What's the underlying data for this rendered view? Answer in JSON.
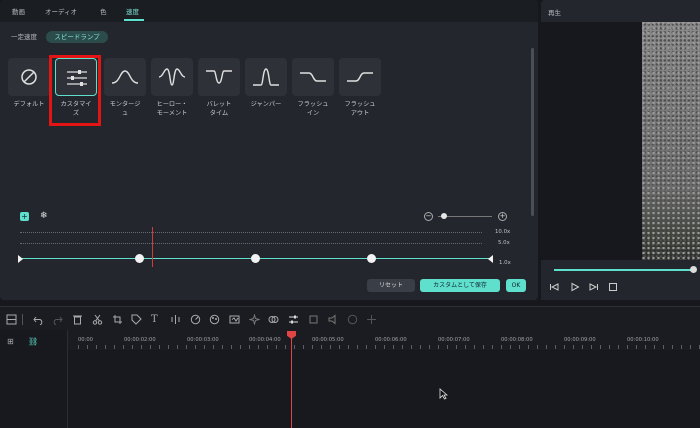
{
  "tabs": [
    "動画",
    "オーディオ",
    "色",
    "速度"
  ],
  "active_tab": "速度",
  "subtabs": [
    "一定速度",
    "スピードランプ"
  ],
  "active_subtab": "スピードランプ",
  "presets": [
    {
      "line1": "デフォルト",
      "line2": "",
      "icon": "none-icon"
    },
    {
      "line1": "カスタマイ",
      "line2": "ズ",
      "icon": "sliders-icon"
    },
    {
      "line1": "モンタージ",
      "line2": "ュ",
      "icon": "montage-curve-icon"
    },
    {
      "line1": "ヒーロー・",
      "line2": "モーメント",
      "icon": "hero-curve-icon"
    },
    {
      "line1": "バレット",
      "line2": "タイム",
      "icon": "bullet-curve-icon"
    },
    {
      "line1": "ジャンパー",
      "line2": "",
      "icon": "jumper-curve-icon"
    },
    {
      "line1": "フラッシュ",
      "line2": "イン",
      "icon": "flash-in-curve-icon"
    },
    {
      "line1": "フラッシュ",
      "line2": "アウト",
      "icon": "flash-out-curve-icon"
    }
  ],
  "selected_preset": "カスタマイズ",
  "graph": {
    "speed_labels": [
      "10.0x",
      "5.0x",
      "1.0x"
    ]
  },
  "buttons": {
    "reset": "リセット",
    "save_custom": "カスタムとして保存",
    "ok": "OK"
  },
  "preview": {
    "title": "再生"
  },
  "timecodes": [
    "00:00",
    "00:00:02:00",
    "00:00:03:00",
    "00:00:04:00",
    "00:00:05:00",
    "00:00:06:00",
    "00:00:07:00",
    "00:00:08:00",
    "00:00:09:00",
    "00:00:10:00"
  ],
  "colors": {
    "accent": "#5fe0cc",
    "highlight": "#e21414",
    "playhead": "#e04444"
  }
}
